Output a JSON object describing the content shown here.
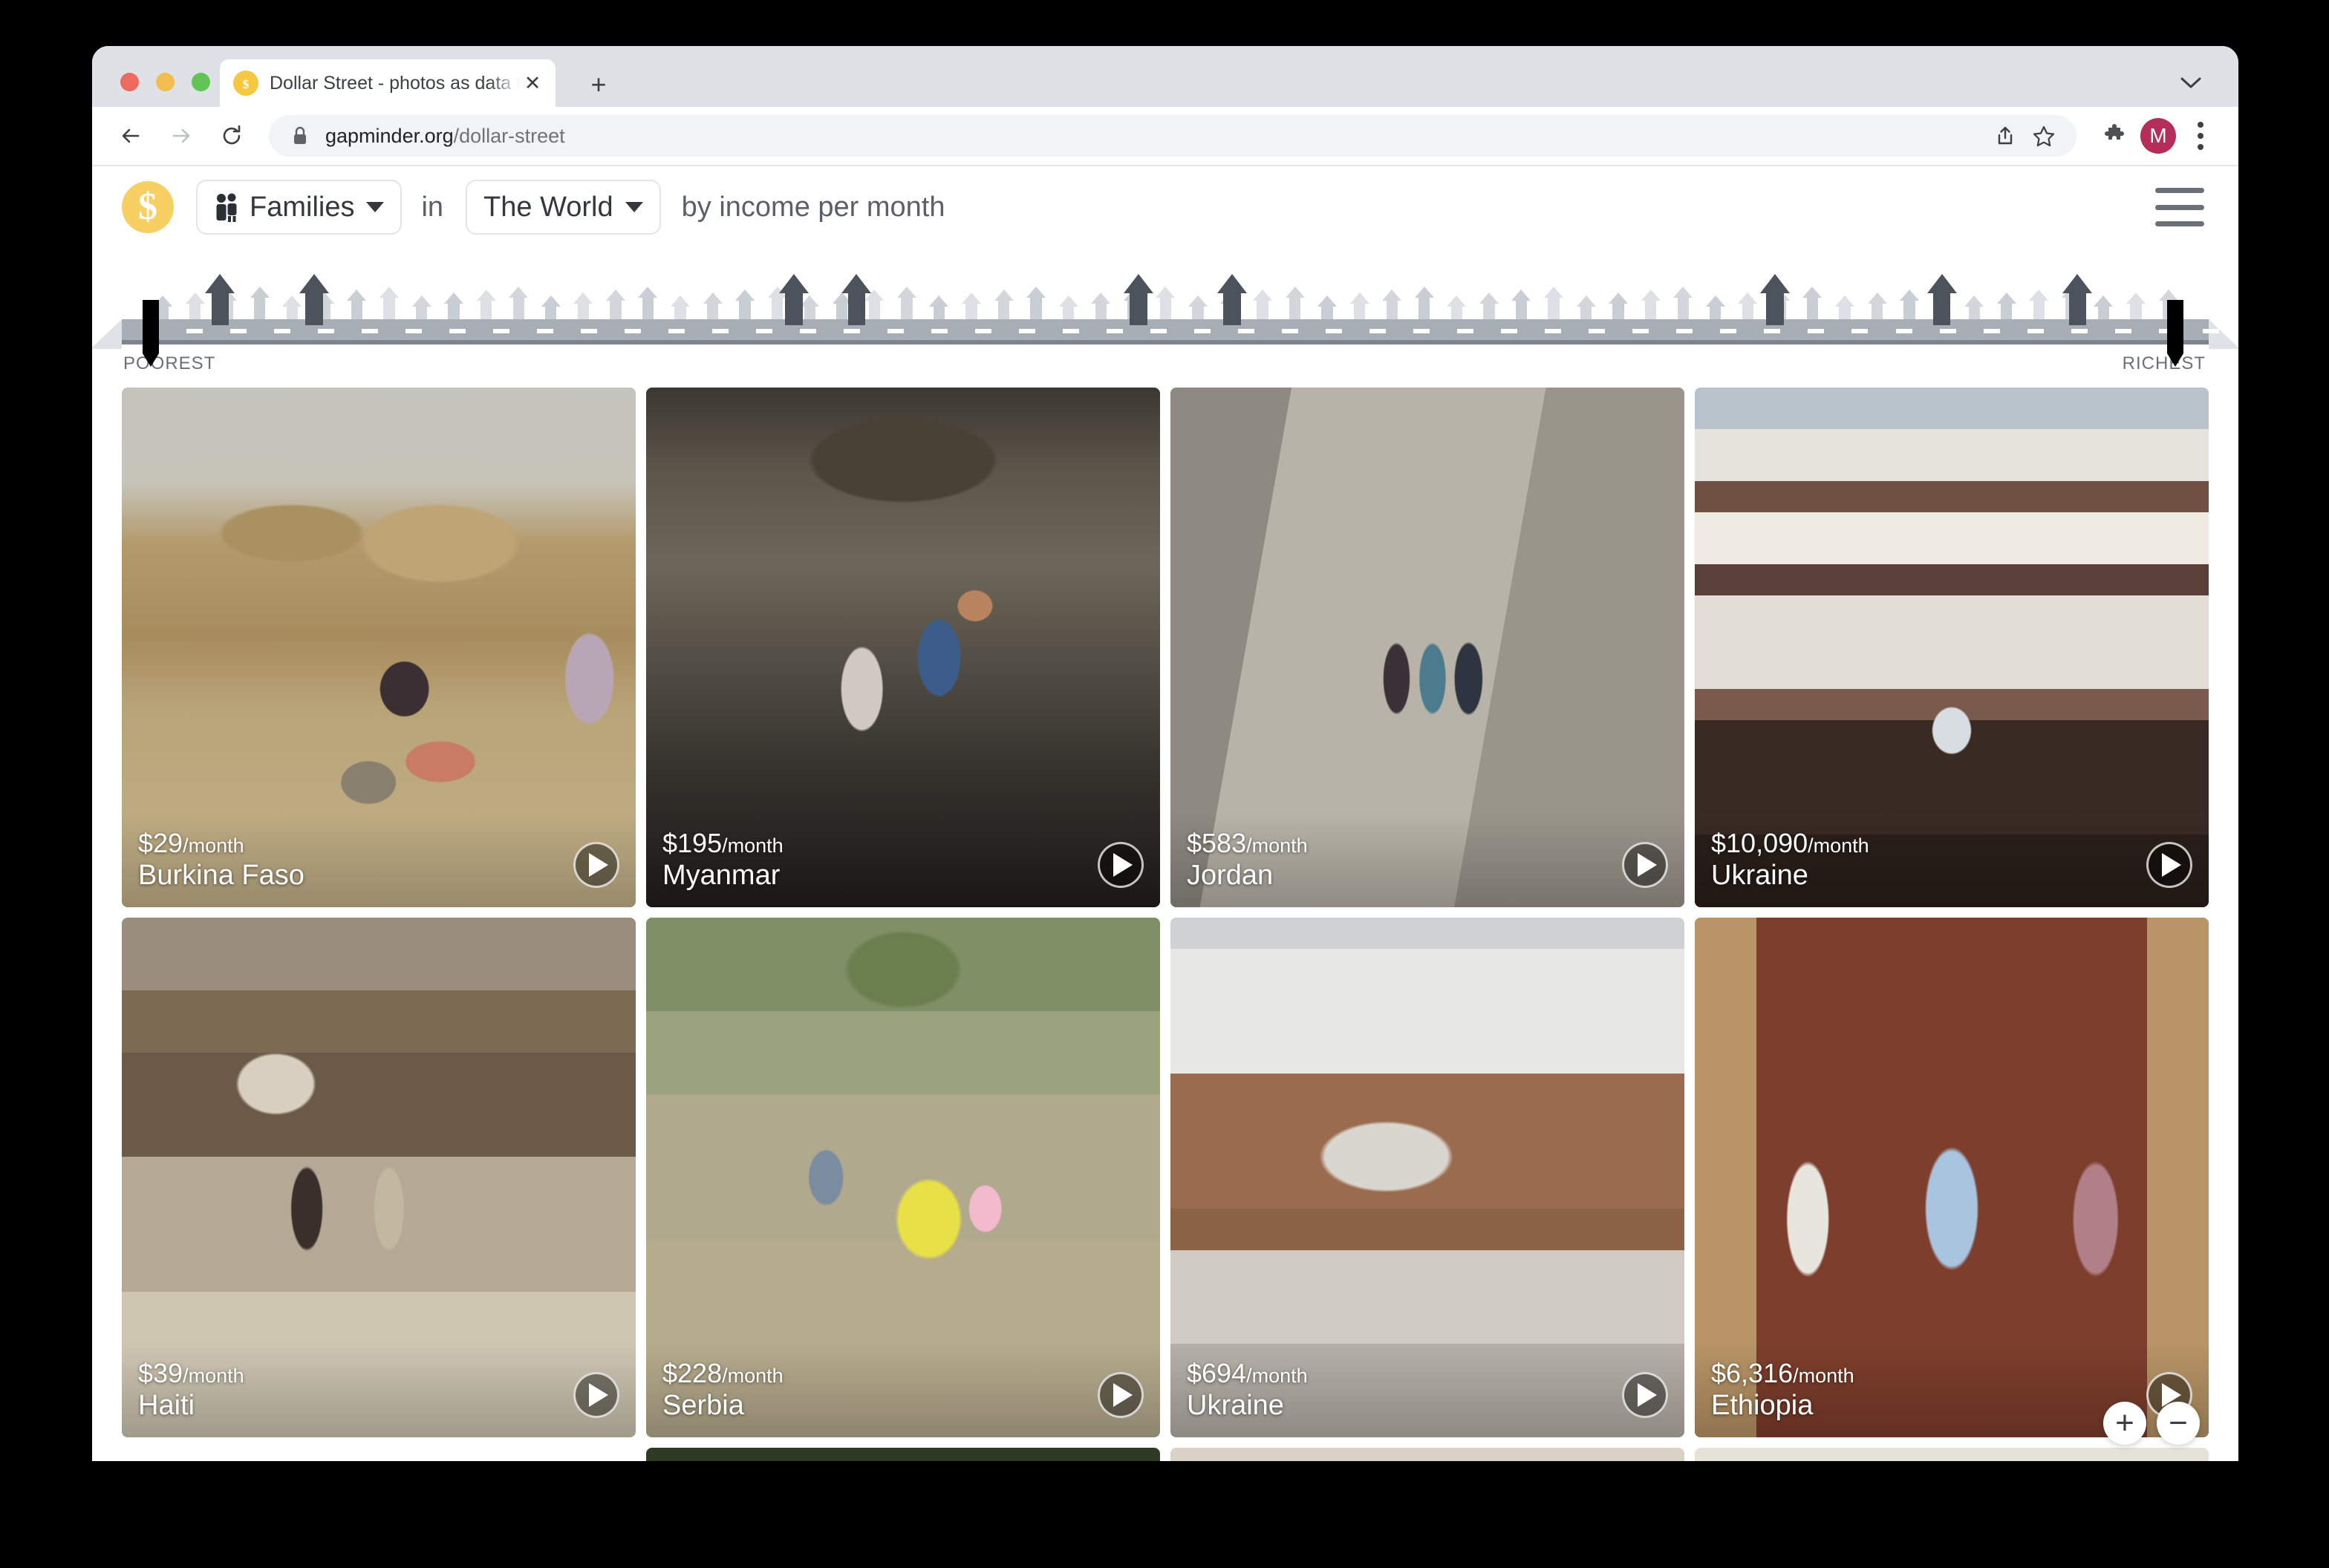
{
  "browser": {
    "tab": {
      "title": "Dollar Street - photos as data t",
      "favicon": "dollar-coin-icon",
      "close_label": "✕"
    },
    "new_tab_label": "+",
    "back_icon": "back-arrow-icon",
    "forward_icon": "forward-arrow-icon",
    "reload_icon": "reload-icon",
    "lock_icon": "lock-icon",
    "url_domain": "gapminder.org",
    "url_path": "/dollar-street",
    "share_icon": "share-icon",
    "bookmark_icon": "star-icon",
    "extensions_icon": "puzzle-piece-icon",
    "profile_initial": "M",
    "menu_icon": "three-dot-menu-icon",
    "window_chevron_icon": "chevron-down-icon"
  },
  "app": {
    "logo_symbol": "$",
    "entity_selector": {
      "label": "Families",
      "icon": "family-people-icon",
      "caret": "chevron-down-icon"
    },
    "connector_word": "in",
    "place_selector": {
      "label": "The World",
      "caret": "chevron-down-icon"
    },
    "measure_text": "by income per month",
    "hamburger_icon": "hamburger-menu-icon"
  },
  "slider": {
    "poorest_label": "POOREST",
    "richest_label": "RICHEST",
    "left_handle_percent": 1,
    "right_handle_percent": 98,
    "highlighted_house_percents": [
      4.0,
      8.5,
      31.5,
      34.5,
      48.0,
      52.5,
      78.5,
      86.5,
      93.0
    ]
  },
  "zoom_controls": {
    "zoom_in_label": "+",
    "zoom_out_label": "−"
  },
  "grid": {
    "rows": [
      [
        {
          "price": "$29",
          "per": "/month",
          "country": "Burkina Faso",
          "scene": "sc-burkina",
          "play_icon": "play-icon"
        },
        {
          "price": "$195",
          "per": "/month",
          "country": "Myanmar",
          "scene": "sc-myanmar",
          "play_icon": "play-icon"
        },
        {
          "price": "$583",
          "per": "/month",
          "country": "Jordan",
          "scene": "sc-jordan",
          "play_icon": "play-icon"
        },
        {
          "price": "$10,090",
          "per": "/month",
          "country": "Ukraine",
          "scene": "sc-ukraine1",
          "play_icon": "play-icon"
        }
      ],
      [
        {
          "price": "$39",
          "per": "/month",
          "country": "Haiti",
          "scene": "sc-haiti",
          "play_icon": "play-icon"
        },
        {
          "price": "$228",
          "per": "/month",
          "country": "Serbia",
          "scene": "sc-serbia",
          "play_icon": "play-icon"
        },
        {
          "price": "$694",
          "per": "/month",
          "country": "Ukraine",
          "scene": "sc-ukraine2",
          "play_icon": "play-icon"
        },
        {
          "price": "$6,316",
          "per": "/month",
          "country": "Ethiopia",
          "scene": "sc-ethiopia",
          "play_icon": "play-icon"
        }
      ]
    ]
  }
}
